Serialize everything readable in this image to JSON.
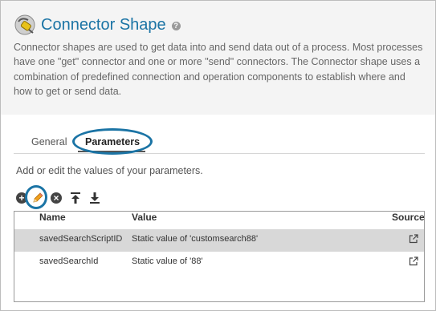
{
  "header": {
    "title": "Connector Shape",
    "help": "?",
    "description": "Connector shapes are used to get data into and send data out of a process. Most processes have one \"get\" connector and one or more \"send\" connectors. The Connector shape uses a combination of predefined connection and operation components to establish where and how to get or send data."
  },
  "tabs": [
    {
      "label": "General"
    },
    {
      "label": "Parameters"
    }
  ],
  "instructions": "Add or edit the values of your parameters.",
  "toolbar": {
    "add": "+",
    "remove": "×"
  },
  "grid": {
    "columns": [
      "Name",
      "Value",
      "Source"
    ],
    "rows": [
      {
        "name": "savedSearchScriptID",
        "value": "Static value of 'customsearch88'"
      },
      {
        "name": "savedSearchId",
        "value": "Static value of '88'"
      }
    ]
  }
}
